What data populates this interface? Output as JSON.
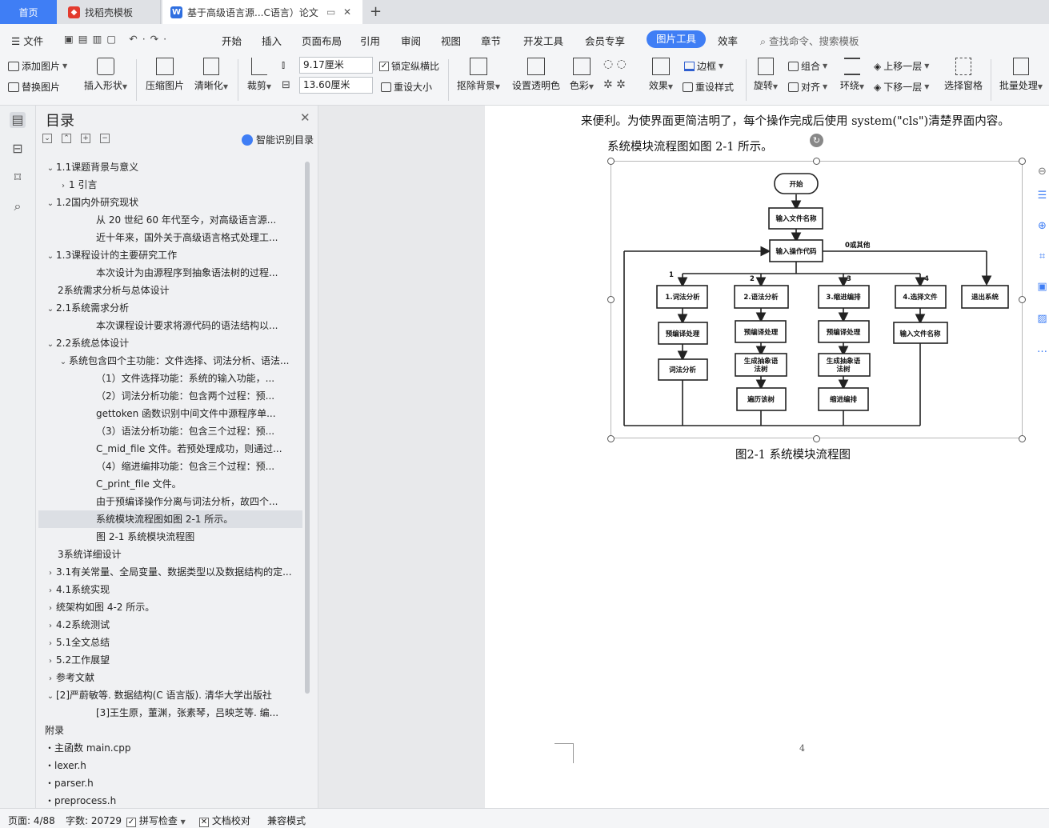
{
  "tabs": {
    "home": "首页",
    "template": "找稻壳模板",
    "document": "基于高级语言源...C语言）论文"
  },
  "menu": {
    "file": "文件",
    "items": [
      "开始",
      "插入",
      "页面布局",
      "引用",
      "审阅",
      "视图",
      "章节",
      "开发工具",
      "会员专享"
    ],
    "active": "图片工具",
    "efficiency": "效率",
    "search_placeholder": "查找命令、搜索模板"
  },
  "ribbon": {
    "add_image": "添加图片",
    "replace_image": "替换图片",
    "insert_shape": "插入形状",
    "compress": "压缩图片",
    "sharpen": "清晰化",
    "crop": "裁剪",
    "width": "9.17厘米",
    "height": "13.60厘米",
    "lock_ratio": "锁定纵横比",
    "reset_size": "重设大小",
    "remove_bg": "抠除背景",
    "set_transparent": "设置透明色",
    "color": "色彩",
    "effect": "效果",
    "border": "边框",
    "reset_style": "重设样式",
    "rotate": "旋转",
    "group": "组合",
    "align": "对齐",
    "wrap": "环绕",
    "bring_forward": "上移一层",
    "send_backward": "下移一层",
    "selection_pane": "选择窗格",
    "batch": "批量处理"
  },
  "toc": {
    "title": "目录",
    "smart": "智能识别目录",
    "items": [
      {
        "text": "1.1课题背景与意义",
        "arrow": "open",
        "indent": 0
      },
      {
        "text": "1 引言",
        "arrow": "closed",
        "indent": 1
      },
      {
        "text": "1.2国内外研究现状",
        "arrow": "open",
        "indent": 0
      },
      {
        "text": "从 20 世纪 60 年代至今，对高级语言源...",
        "arrow": "",
        "indent": 4
      },
      {
        "text": "近十年来，国外关于高级语言格式处理工...",
        "arrow": "",
        "indent": 4
      },
      {
        "text": "1.3课程设计的主要研究工作",
        "arrow": "open",
        "indent": 0
      },
      {
        "text": "本次设计为由源程序到抽象语法树的过程...",
        "arrow": "",
        "indent": 4
      },
      {
        "text": "2系统需求分析与总体设计",
        "arrow": "",
        "indent": 1
      },
      {
        "text": "2.1系统需求分析",
        "arrow": "open",
        "indent": 0
      },
      {
        "text": "本次课程设计要求将源代码的语法结构以...",
        "arrow": "",
        "indent": 4
      },
      {
        "text": "2.2系统总体设计",
        "arrow": "open",
        "indent": 0
      },
      {
        "text": "系统包含四个主功能：文件选择、词法分析、语法...",
        "arrow": "open",
        "indent": 1
      },
      {
        "text": "（1）文件选择功能：系统的输入功能，...",
        "arrow": "",
        "indent": 4
      },
      {
        "text": "（2）词法分析功能：包含两个过程：预...",
        "arrow": "",
        "indent": 4
      },
      {
        "text": "gettoken 函数识别中间文件中源程序单...",
        "arrow": "",
        "indent": 4
      },
      {
        "text": "（3）语法分析功能：包含三个过程：预...",
        "arrow": "",
        "indent": 4
      },
      {
        "text": "C_mid_file 文件。若预处理成功，则通过...",
        "arrow": "",
        "indent": 4
      },
      {
        "text": "（4）缩进编排功能：包含三个过程：预...",
        "arrow": "",
        "indent": 4
      },
      {
        "text": "C_print_file 文件。",
        "arrow": "",
        "indent": 4
      },
      {
        "text": "由于预编译操作分离与词法分析，故四个...",
        "arrow": "",
        "indent": 4
      },
      {
        "text": "系统模块流程图如图 2-1 所示。",
        "arrow": "",
        "indent": 4,
        "selected": true
      },
      {
        "text": "图 2-1  系统模块流程图",
        "arrow": "",
        "indent": 4
      },
      {
        "text": "3系统详细设计",
        "arrow": "",
        "indent": 1
      },
      {
        "text": "3.1有关常量、全局变量、数据类型以及数据结构的定...",
        "arrow": "closed",
        "indent": 0
      },
      {
        "text": "4.1系统实现",
        "arrow": "closed",
        "indent": 0
      },
      {
        "text": "统架构如图 4-2 所示。",
        "arrow": "closed",
        "indent": 0
      },
      {
        "text": "4.2系统测试",
        "arrow": "closed",
        "indent": 0
      },
      {
        "text": "5.1全文总结",
        "arrow": "closed",
        "indent": 0
      },
      {
        "text": "5.2工作展望",
        "arrow": "closed",
        "indent": 0
      },
      {
        "text": "参考文献",
        "arrow": "closed",
        "indent": 0
      },
      {
        "text": "[2]严蔚敏等. 数据结构(C 语言版). 清华大学出版社",
        "arrow": "open",
        "indent": 0
      },
      {
        "text": "[3]王生原，董渊，张素琴，吕映芝等. 编...",
        "arrow": "",
        "indent": 4
      },
      {
        "text": "附录",
        "arrow": "",
        "indent": 0
      },
      {
        "text": "・主函数 main.cpp",
        "arrow": "",
        "indent": 0
      },
      {
        "text": "・lexer.h",
        "arrow": "",
        "indent": 0
      },
      {
        "text": "・parser.h",
        "arrow": "",
        "indent": 0
      },
      {
        "text": "・preprocess.h",
        "arrow": "",
        "indent": 0
      }
    ]
  },
  "document": {
    "line1": "来便利。为使界面更简洁明了，每个操作完成后使用 system(\"cls\")清楚界面内容。",
    "line2": "系统模块流程图如图 2-1 所示。",
    "caption": "图2-1     系统模块流程图",
    "page_number": "4"
  },
  "flowchart": {
    "start": "开始",
    "input_file": "输入文件名称",
    "input_code": "输入操作代码",
    "other": "0或其他",
    "labels": [
      "1",
      "2",
      "3",
      "4"
    ],
    "col1": [
      "1.词法分析",
      "预编译处理",
      "词法分析"
    ],
    "col2": [
      "2.语法分析",
      "预编译处理",
      "生成抽象语\n法树",
      "遍历该树"
    ],
    "col3": [
      "3.缩进编排",
      "预编译处理",
      "生成抽象语\n法树",
      "缩进编排"
    ],
    "col4": [
      "4.选择文件",
      "输入文件名称"
    ],
    "exit": "退出系统"
  },
  "status": {
    "page": "页面: 4/88",
    "words": "字数: 20729",
    "spell": "拼写检查",
    "proof": "文档校对",
    "compat": "兼容模式"
  }
}
